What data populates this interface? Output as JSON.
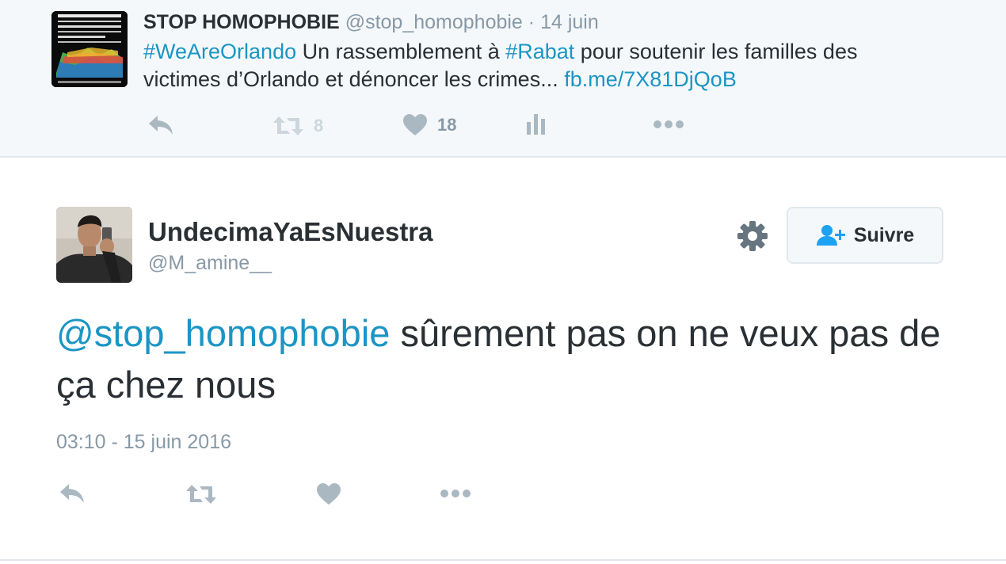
{
  "quoted_tweet": {
    "avatar_text": "PAS BESOIN D'ETRE HOMOSEXUEL POUR DEFENDRE LES DROITS DES LGBT IL SUFFIT D'ETRE HUMAIN",
    "name": "STOP HOMOPHOBIE",
    "handle": "@stop_homophobie",
    "separator": "·",
    "date": "14 juin",
    "text": {
      "hashtag1": "#WeAreOrlando",
      "part1": " Un rassemblement à ",
      "hashtag2": "#Rabat",
      "part2": " pour soutenir les familles des victimes d’Orlando et dénoncer les crimes... ",
      "link": "fb.me/7X81DjQoB"
    },
    "actions": {
      "reply_icon": "reply-icon",
      "retweet_icon": "retweet-icon",
      "retweet_count": "8",
      "like_icon": "heart-icon",
      "like_count": "18",
      "analytics_icon": "bar-chart-icon",
      "more_icon": "more-dots-icon"
    }
  },
  "tweet": {
    "user_name": "UndecimaYaEsNuestra",
    "handle": "@M_amine__",
    "follow_label": "Suivre",
    "mention": "@stop_homophobie",
    "text": " sûrement pas on ne veux pas de ça chez nous",
    "timestamp": "03:10 - 15 juin 2016"
  },
  "colors": {
    "link": "#1b95c4",
    "text": "#292f33",
    "muted": "#8899a6",
    "icon": "#aab8c2",
    "quoted_bg": "#f5f8fa",
    "border": "#e1e8ed"
  }
}
